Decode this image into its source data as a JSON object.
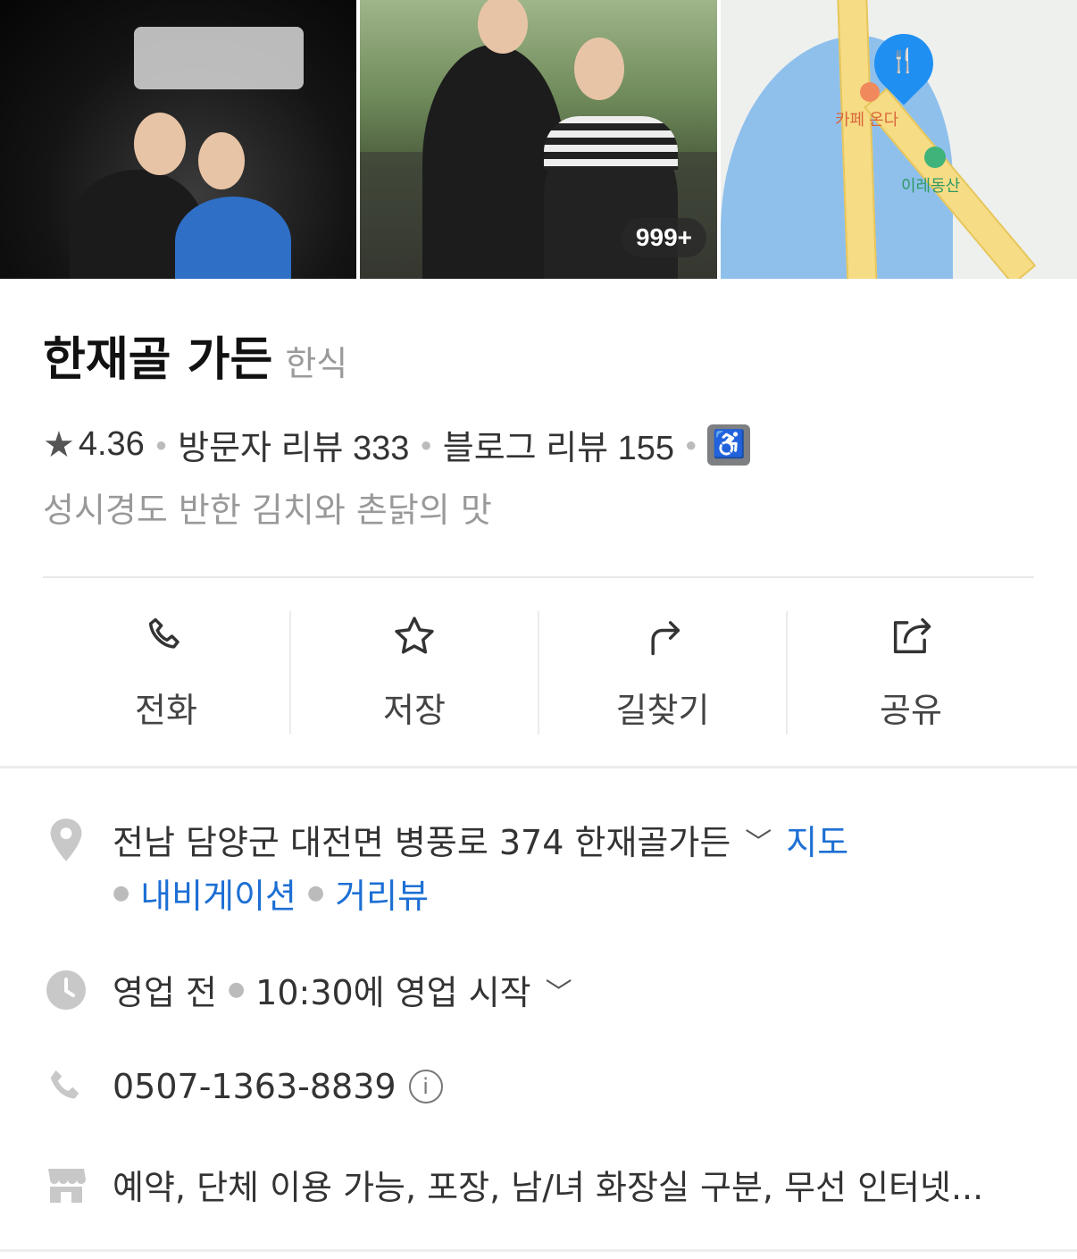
{
  "photos": {
    "count_badge": "999+",
    "map_labels": {
      "cafe": "카페 온다",
      "mountain": "이레동산"
    }
  },
  "place": {
    "name": "한재골 가든",
    "category": "한식"
  },
  "stats": {
    "rating": "4.36",
    "visitor_reviews": "방문자 리뷰 333",
    "blog_reviews": "블로그 리뷰 155"
  },
  "tagline": "성시경도 반한 김치와 촌닭의 맛",
  "actions": {
    "call": "전화",
    "save": "저장",
    "directions": "길찾기",
    "share": "공유"
  },
  "address": {
    "text": "전남 담양군 대전면 병풍로 374 한재골가든",
    "map_link": "지도",
    "navigation_link": "내비게이션",
    "street_view_link": "거리뷰"
  },
  "hours": {
    "status": "영업 전",
    "detail": "10:30에 영업 시작"
  },
  "phone": {
    "number": "0507-1363-8839"
  },
  "amenities": {
    "text": "예약, 단체 이용 가능, 포장, 남/녀 화장실 구분, 무선 인터넷..."
  },
  "colors": {
    "link": "#1d6fd4",
    "icon_gray": "#c8c8c8",
    "map_pin": "#1f8ff2"
  }
}
